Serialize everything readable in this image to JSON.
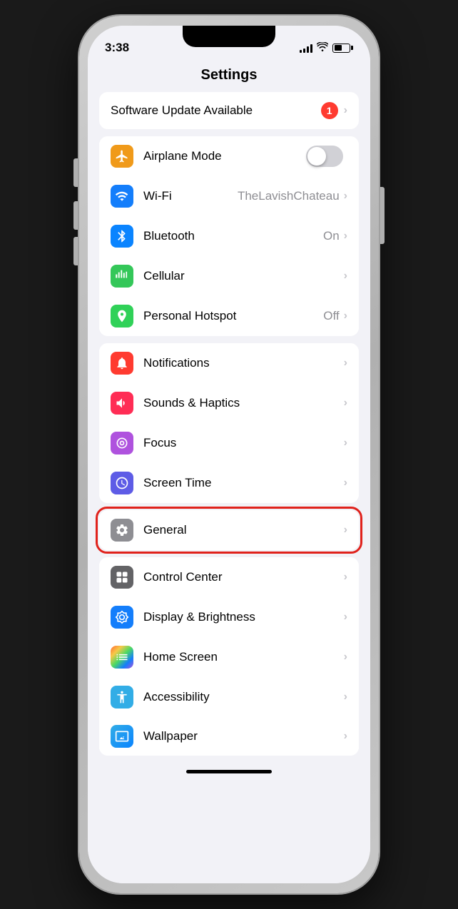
{
  "status": {
    "time": "3:38",
    "battery_pct": 50
  },
  "page": {
    "title": "Settings"
  },
  "update_row": {
    "label": "Software Update Available",
    "badge": "1"
  },
  "connectivity_section": [
    {
      "id": "airplane-mode",
      "label": "Airplane Mode",
      "icon": "airplane",
      "icon_color": "orange",
      "has_toggle": true,
      "toggle_on": false,
      "value": "",
      "chevron": true
    },
    {
      "id": "wifi",
      "label": "Wi-Fi",
      "icon": "wifi",
      "icon_color": "blue",
      "has_toggle": false,
      "value": "TheLavishChateau",
      "chevron": true
    },
    {
      "id": "bluetooth",
      "label": "Bluetooth",
      "icon": "bluetooth",
      "icon_color": "blue-dark",
      "has_toggle": false,
      "value": "On",
      "chevron": true
    },
    {
      "id": "cellular",
      "label": "Cellular",
      "icon": "cellular",
      "icon_color": "green",
      "has_toggle": false,
      "value": "",
      "chevron": true
    },
    {
      "id": "personal-hotspot",
      "label": "Personal Hotspot",
      "icon": "hotspot",
      "icon_color": "green2",
      "has_toggle": false,
      "value": "Off",
      "chevron": true
    }
  ],
  "notifications_section": [
    {
      "id": "notifications",
      "label": "Notifications",
      "icon": "notifications",
      "icon_color": "red",
      "value": "",
      "chevron": true
    },
    {
      "id": "sounds",
      "label": "Sounds & Haptics",
      "icon": "sounds",
      "icon_color": "pink",
      "value": "",
      "chevron": true
    },
    {
      "id": "focus",
      "label": "Focus",
      "icon": "focus",
      "icon_color": "purple",
      "value": "",
      "chevron": true
    },
    {
      "id": "screen-time",
      "label": "Screen Time",
      "icon": "screen-time",
      "icon_color": "purple2",
      "value": "",
      "chevron": true
    }
  ],
  "general_row": {
    "label": "General",
    "icon": "general",
    "icon_color": "gray",
    "value": "",
    "chevron": true,
    "highlighted": true
  },
  "bottom_section": [
    {
      "id": "control-center",
      "label": "Control Center",
      "icon": "control-center",
      "icon_color": "gray2",
      "value": "",
      "chevron": true
    },
    {
      "id": "display-brightness",
      "label": "Display & Brightness",
      "icon": "display",
      "icon_color": "blue",
      "value": "",
      "chevron": true
    },
    {
      "id": "home-screen",
      "label": "Home Screen",
      "icon": "home-screen",
      "icon_color": "blue-dark",
      "value": "",
      "chevron": true
    },
    {
      "id": "accessibility",
      "label": "Accessibility",
      "icon": "accessibility",
      "icon_color": "teal",
      "value": "",
      "chevron": true
    },
    {
      "id": "wallpaper",
      "label": "Wallpaper",
      "icon": "wallpaper",
      "icon_color": "teal",
      "value": "",
      "chevron": true
    }
  ]
}
